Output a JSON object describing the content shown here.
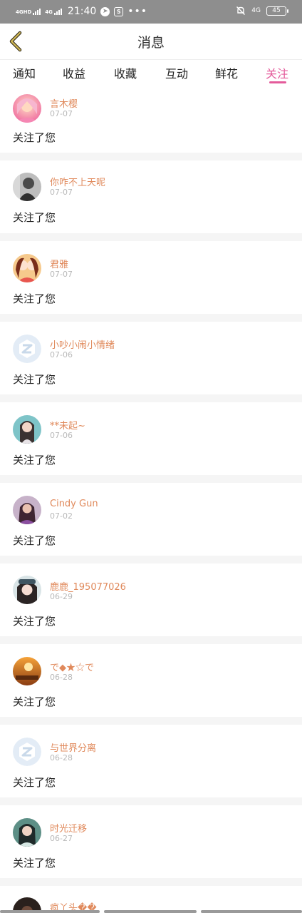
{
  "status_bar": {
    "sim1_tag": "4GHD",
    "sim2_tag": "4G",
    "time": "21:40",
    "app_icon_1": "navigation-icon",
    "app_icon_2": "S",
    "more": "•••",
    "mute_icon": "mute-icon",
    "network_right": "4G",
    "battery": "45"
  },
  "nav": {
    "back_icon": "chevron-left-icon",
    "title": "消息"
  },
  "tabs": [
    {
      "label": "通知",
      "active": false
    },
    {
      "label": "收益",
      "active": false
    },
    {
      "label": "收藏",
      "active": false
    },
    {
      "label": "互动",
      "active": false
    },
    {
      "label": "鲜花",
      "active": false
    },
    {
      "label": "关注",
      "active": true
    }
  ],
  "colors": {
    "accent": "#e45b9b",
    "username": "#e0895b",
    "date": "#b9b9b9",
    "separator": "#f5f5f5",
    "status_bar": "#8e8e8e"
  },
  "items": [
    {
      "name": "言木樱",
      "date": "07-07",
      "message": "关注了您",
      "avatar": "photo-avatar"
    },
    {
      "name": "你咋不上天呢",
      "date": "07-07",
      "message": "关注了您",
      "avatar": "photo-avatar"
    },
    {
      "name": "君雅",
      "date": "07-07",
      "message": "关注了您",
      "avatar": "photo-avatar"
    },
    {
      "name": "小吵小闹小情绪",
      "date": "07-06",
      "message": "关注了您",
      "avatar": "default-avatar-icon"
    },
    {
      "name": "**未起~",
      "date": "07-06",
      "message": "关注了您",
      "avatar": "photo-avatar"
    },
    {
      "name": "Cindy Gun",
      "date": "07-02",
      "message": "关注了您",
      "avatar": "photo-avatar"
    },
    {
      "name": "鹿鹿_195077026",
      "date": "06-29",
      "message": "关注了您",
      "avatar": "photo-avatar"
    },
    {
      "name": "で◆★☆で",
      "date": "06-28",
      "message": "关注了您",
      "avatar": "photo-avatar"
    },
    {
      "name": "与世界分离",
      "date": "06-28",
      "message": "关注了您",
      "avatar": "default-avatar-icon"
    },
    {
      "name": "时光迁移",
      "date": "06-27",
      "message": "关注了您",
      "avatar": "photo-avatar"
    },
    {
      "name": "疯丫头��",
      "date": "",
      "message": "",
      "avatar": "photo-avatar"
    }
  ]
}
